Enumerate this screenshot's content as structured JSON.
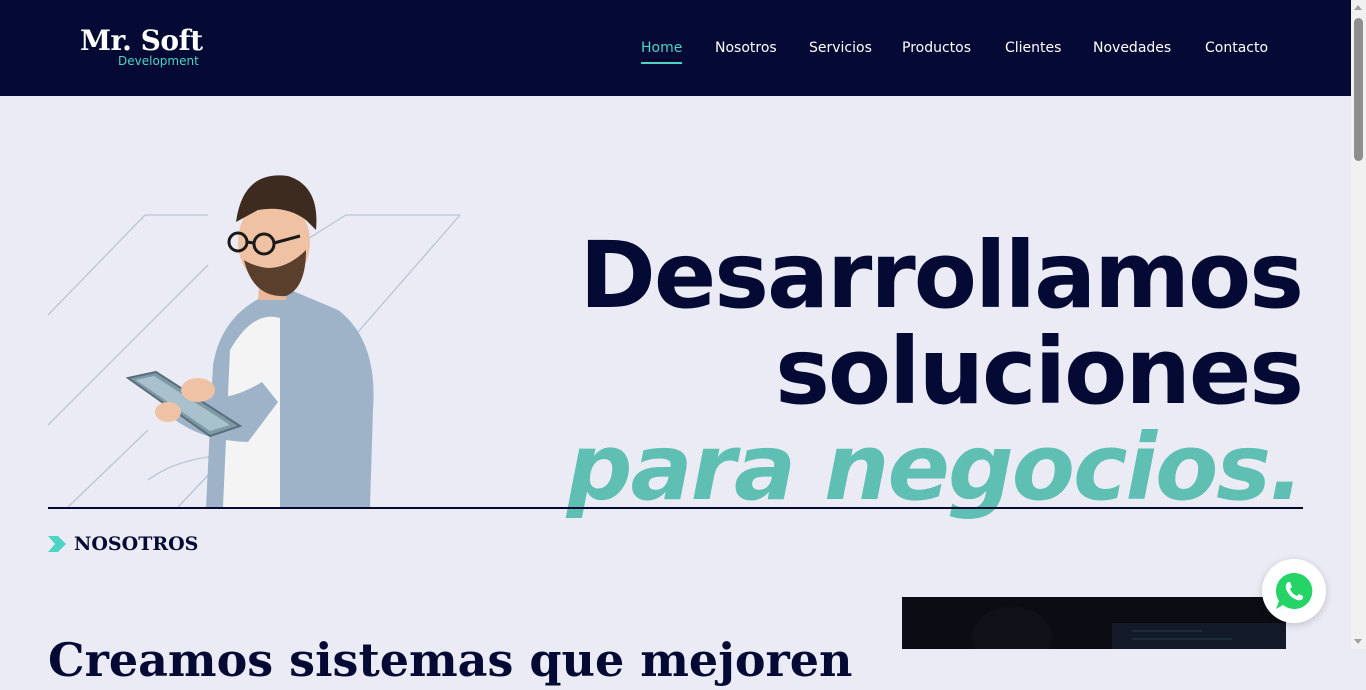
{
  "logo": {
    "main": "Mr. Soft",
    "sub": "Development"
  },
  "nav": {
    "items": [
      {
        "label": "Home",
        "active": true
      },
      {
        "label": "Nosotros"
      },
      {
        "label": "Servicios"
      },
      {
        "label": "Productos"
      },
      {
        "label": "Clientes"
      },
      {
        "label": "Novedades"
      },
      {
        "label": "Contacto"
      }
    ]
  },
  "hero": {
    "line1": "Desarrollamos",
    "line2": "soluciones",
    "line3": "para negocios."
  },
  "about": {
    "label": "NOSOTROS",
    "heading": "Creamos sistemas que mejoren"
  },
  "icons": {
    "whatsapp": "whatsapp-icon",
    "section_marker": "chevron-right-icon"
  },
  "colors": {
    "navy": "#040a33",
    "teal": "#4fd3c4",
    "accent_text": "#5fbfb2",
    "background": "#eaebf5",
    "whatsapp_green": "#25d366"
  }
}
